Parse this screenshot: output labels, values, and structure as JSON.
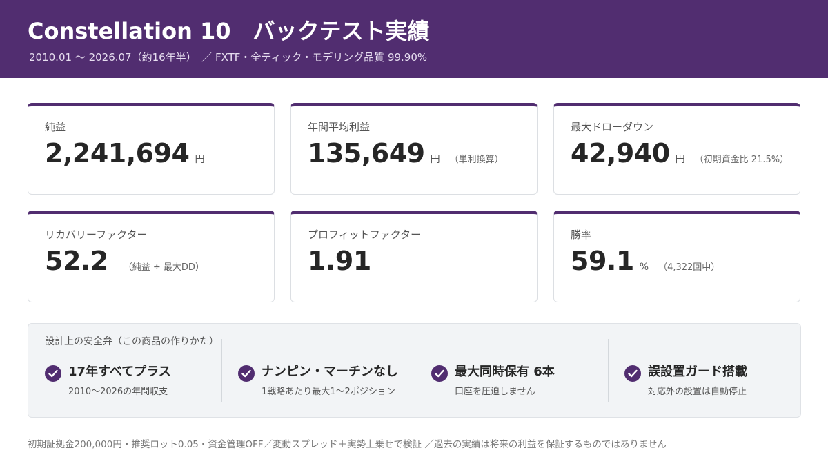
{
  "header": {
    "title": "Constellation 10　バックテスト実績",
    "subtitle": "2010.01 〜 2026.07（約16年半）　／ FXTF・全ティック・モデリング品質 99.90%"
  },
  "colors": {
    "brand": "#512d70",
    "card_border": "#dcdfe3",
    "panel_bg": "#f2f4f6"
  },
  "stats": [
    {
      "label": "純益",
      "value": "2,241,694",
      "unit": "円",
      "note": ""
    },
    {
      "label": "年間平均利益",
      "value": "135,649",
      "unit": "円",
      "note": "（単利換算）"
    },
    {
      "label": "最大ドローダウン",
      "value": "42,940",
      "unit": "円",
      "note": "（初期資金比 21.5%）"
    },
    {
      "label": "リカバリーファクター",
      "value": "52.2",
      "unit": "",
      "note": "（純益 ÷ 最大DD）"
    },
    {
      "label": "プロフィットファクター",
      "value": "1.91",
      "unit": "",
      "note": ""
    },
    {
      "label": "勝率",
      "value": "59.1",
      "unit": "%",
      "note": "（4,322回中）"
    }
  ],
  "design": {
    "heading": "設計上の安全弁（この商品の作りかた）",
    "features": [
      {
        "icon": "check-circle-icon",
        "title": "17年すべてプラス",
        "desc": "2010〜2026の年間収支"
      },
      {
        "icon": "check-circle-icon",
        "title": "ナンピン・マーチンなし",
        "desc": "1戦略あたり最大1〜2ポジション"
      },
      {
        "icon": "check-circle-icon",
        "title": "最大同時保有 6本",
        "desc": "口座を圧迫しません"
      },
      {
        "icon": "check-circle-icon",
        "title": "誤設置ガード搭載",
        "desc": "対応外の設置は自動停止"
      }
    ]
  },
  "footer": {
    "text": "初期証拠金200,000円・推奨ロット0.05・資金管理OFF／変動スプレッド＋実勢上乗せで検証 ／過去の実績は将来の利益を保証するものではありません"
  }
}
